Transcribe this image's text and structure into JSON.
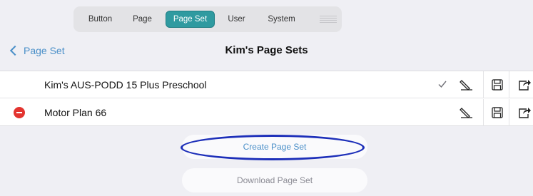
{
  "tabs": [
    {
      "label": "Button"
    },
    {
      "label": "Page"
    },
    {
      "label": "Page Set",
      "selected": true
    },
    {
      "label": "User"
    },
    {
      "label": "System"
    }
  ],
  "nav": {
    "back_label": "Page Set",
    "title": "Kim's Page Sets"
  },
  "page_sets": [
    {
      "name": "Kim's AUS-PODD 15 Plus Preschool",
      "active": true,
      "deletable": false
    },
    {
      "name": "Motor Plan 66",
      "active": false,
      "deletable": true
    }
  ],
  "actions": {
    "create_label": "Create Page Set",
    "download_label": "Download Page Set"
  },
  "colors": {
    "accent": "#2f9aa0",
    "link": "#4a8fc8",
    "delete": "#e3342f",
    "highlight_ring": "#1d2fb9",
    "background": "#efeff4"
  },
  "icons": {
    "row_buttons": [
      "edit-icon",
      "save-icon",
      "share-icon"
    ],
    "active_marker": "checkmark-icon",
    "delete_marker": "delete-icon"
  }
}
